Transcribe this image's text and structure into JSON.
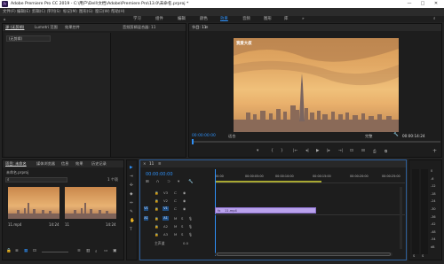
{
  "titlebar": {
    "title": "Adobe Premiere Pro CC 2019 - C:\\用户\\Dell\\文档\\Adobe\\Premiere Pro\\13.0\\未命名.prproj *",
    "logo_text": "Pr",
    "min": "—",
    "max": "□",
    "close": "✕"
  },
  "menu": [
    "文件(F)",
    "编辑(E)",
    "剪辑(C)",
    "序列(S)",
    "标记(M)",
    "图形(G)",
    "窗口(W)",
    "帮助(H)"
  ],
  "workspaces": [
    "学习",
    "组件",
    "编辑",
    "颜色",
    "效果",
    "音频",
    "图形",
    "库"
  ],
  "workspace_active_index": 4,
  "source_panel": {
    "tabs": [
      "源:(无剪辑)",
      "Lumetri 范围",
      "效果控件",
      "音频剪辑混合器: 11"
    ],
    "file_label": "(无剪辑)"
  },
  "program": {
    "tab": "节目: 11",
    "overlay_text": "我爱大叔",
    "timecode": "00:00:00:00",
    "fit": "适合",
    "zoom": "完整",
    "duration": "00:00:14:24",
    "color_accent": "#2e8ff5"
  },
  "project": {
    "tabs": [
      "项目: 未命名",
      "媒体浏览器",
      "信息",
      "效果",
      "历史记录"
    ],
    "project_file": "未命名.prproj",
    "item_count": "1 个项",
    "clips": [
      {
        "name": "11.mp4",
        "duration": "14:24"
      },
      {
        "name": "11",
        "duration": "14:24"
      }
    ]
  },
  "timeline": {
    "tab": "11",
    "timecode": "00:00:00:00",
    "ruler": [
      "00:00",
      "00:00:05:00",
      "00:00:10:00",
      "00:00:15:00",
      "00:00:20:00",
      "00:00:25:00"
    ],
    "video_tracks": [
      "V3",
      "V2",
      "V1"
    ],
    "audio_tracks": [
      "A1",
      "A2",
      "A3"
    ],
    "master": "主声道",
    "master_value": "0.0",
    "clip_label": "11.mp4",
    "clip_color": "#b9a2ec"
  },
  "audio_meter": {
    "labels": [
      "0",
      "-6",
      "-12",
      "-18",
      "-24",
      "-30",
      "-36",
      "-42",
      "-48",
      "-54",
      "dB"
    ],
    "solo": "S",
    "solo2": "S"
  }
}
